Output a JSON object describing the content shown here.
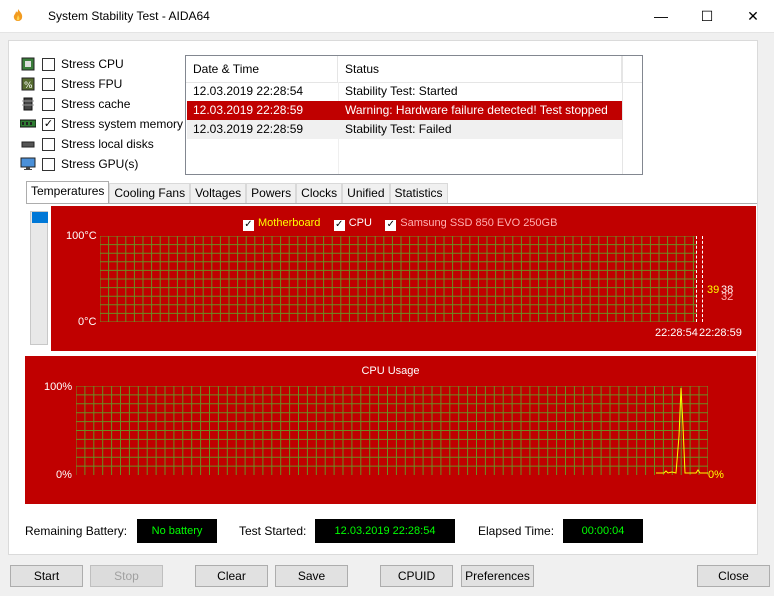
{
  "window": {
    "title": "System Stability Test - AIDA64",
    "controls": {
      "minimize": "—",
      "maximize": "☐",
      "close": "✕"
    }
  },
  "stress": [
    {
      "label": "Stress CPU",
      "checked": false,
      "icon": "cpu-chip-icon"
    },
    {
      "label": "Stress FPU",
      "checked": false,
      "icon": "fpu-icon"
    },
    {
      "label": "Stress cache",
      "checked": false,
      "icon": "cache-icon"
    },
    {
      "label": "Stress system memory",
      "checked": true,
      "icon": "memory-module-icon"
    },
    {
      "label": "Stress local disks",
      "checked": false,
      "icon": "disk-drive-icon"
    },
    {
      "label": "Stress GPU(s)",
      "checked": false,
      "icon": "monitor-icon"
    }
  ],
  "log": {
    "headers": {
      "datetime": "Date & Time",
      "status": "Status"
    },
    "rows": [
      {
        "datetime": "12.03.2019 22:28:54",
        "status": "Stability Test: Started",
        "highlight": false
      },
      {
        "datetime": "12.03.2019 22:28:59",
        "status": "Warning: Hardware failure detected! Test stopped",
        "highlight": true
      },
      {
        "datetime": "12.03.2019 22:28:59",
        "status": "Stability Test: Failed",
        "highlight": false
      }
    ]
  },
  "tabs": [
    "Temperatures",
    "Cooling Fans",
    "Voltages",
    "Powers",
    "Clocks",
    "Unified",
    "Statistics"
  ],
  "active_tab": "Temperatures",
  "temp_chart": {
    "legend": [
      {
        "label": "Motherboard",
        "color": "#ffff00"
      },
      {
        "label": "CPU",
        "color": "#ffffff"
      },
      {
        "label": "Samsung SSD 850 EVO 250GB",
        "color": "#ffb0b0"
      }
    ],
    "y_max": "100°C",
    "y_min": "0°C",
    "x_start": "22:28:54",
    "x_end": "22:28:59",
    "readings": {
      "motherboard": "39",
      "cpu": "38",
      "ssd": "32"
    }
  },
  "cpu_chart": {
    "title": "CPU Usage",
    "y_max": "100%",
    "y_min": "0%",
    "current": "0%"
  },
  "status": {
    "battery_label": "Remaining Battery:",
    "battery_value": "No battery",
    "started_label": "Test Started:",
    "started_value": "12.03.2019 22:28:54",
    "elapsed_label": "Elapsed Time:",
    "elapsed_value": "00:00:04"
  },
  "buttons": {
    "start": "Start",
    "stop": "Stop",
    "clear": "Clear",
    "save": "Save",
    "cpuid": "CPUID",
    "preferences": "Preferences",
    "close": "Close"
  },
  "colors": {
    "panel": "#c00000",
    "grid": "#6b8e23",
    "accent": "#0078d7",
    "highlight_row": "#c00000"
  }
}
